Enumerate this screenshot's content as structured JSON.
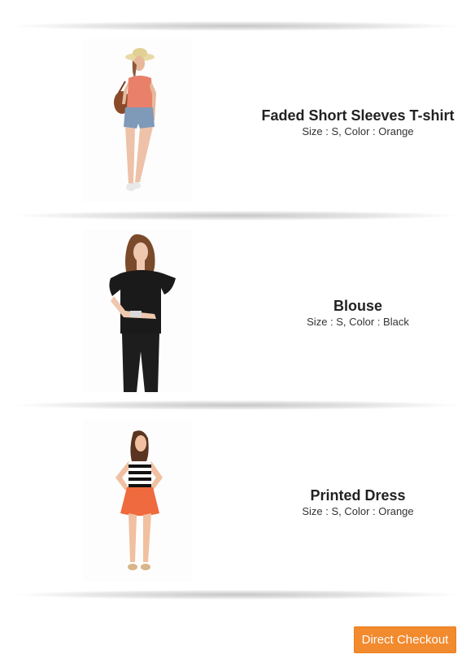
{
  "cart": {
    "items": [
      {
        "name": "Faded Short Sleeves T-shirt",
        "attributes": "Size : S, Color : Orange",
        "image_icon": "model-orange-top-denim-shorts-image"
      },
      {
        "name": "Blouse",
        "attributes": "Size : S, Color : Black",
        "image_icon": "model-black-blouse-image"
      },
      {
        "name": "Printed Dress",
        "attributes": "Size : S, Color : Orange",
        "image_icon": "model-striped-top-orange-skirt-image"
      }
    ],
    "checkout_label": "Direct Checkout",
    "colors": {
      "accent": "#f28a2e",
      "text": "#333333"
    }
  }
}
